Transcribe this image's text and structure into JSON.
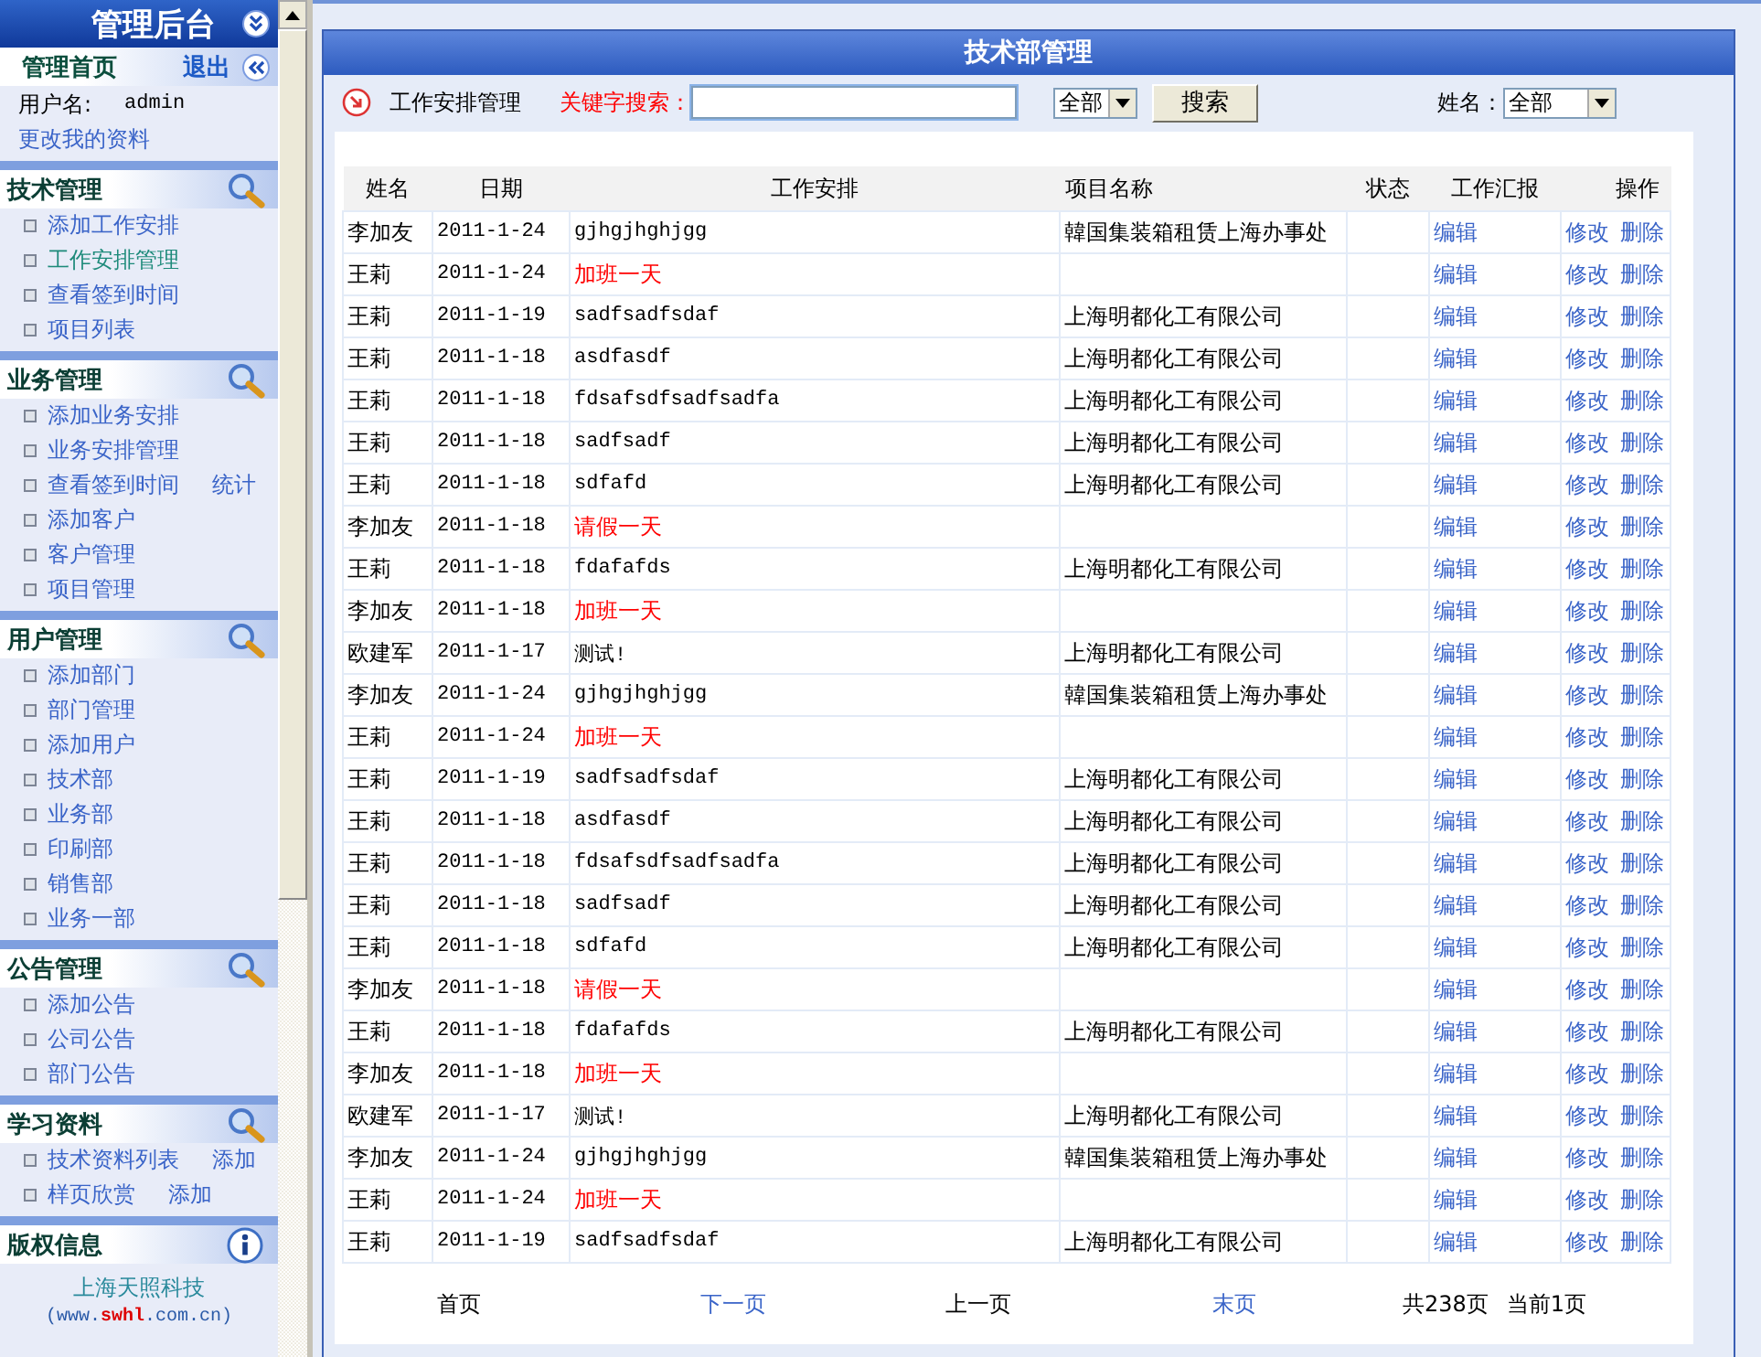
{
  "sidebar": {
    "title": "管理后台",
    "home": "管理首页",
    "logout": "退出",
    "user_label": "用户名:",
    "user": "admin",
    "edit_profile": "更改我的资料",
    "sections": [
      {
        "title": "技术管理",
        "kind": "search",
        "items": [
          {
            "label": "添加工作安排",
            "selected": false
          },
          {
            "label": "工作安排管理",
            "selected": true
          },
          {
            "label": "查看签到时间",
            "selected": false
          },
          {
            "label": "项目列表",
            "selected": false
          }
        ]
      },
      {
        "title": "业务管理",
        "kind": "search",
        "items": [
          {
            "label": "添加业务安排",
            "selected": false
          },
          {
            "label": "业务安排管理",
            "selected": false
          },
          {
            "label": "查看签到时间",
            "extra": "统计",
            "selected": false
          },
          {
            "label": "添加客户",
            "selected": false
          },
          {
            "label": "客户管理",
            "selected": false
          },
          {
            "label": "项目管理",
            "selected": false
          }
        ]
      },
      {
        "title": "用户管理",
        "kind": "search",
        "items": [
          {
            "label": "添加部门",
            "selected": false
          },
          {
            "label": "部门管理",
            "selected": false
          },
          {
            "label": "添加用户",
            "selected": false
          },
          {
            "label": "技术部",
            "selected": false
          },
          {
            "label": "业务部",
            "selected": false
          },
          {
            "label": "印刷部",
            "selected": false
          },
          {
            "label": "销售部",
            "selected": false
          },
          {
            "label": "业务一部",
            "selected": false
          }
        ]
      },
      {
        "title": "公告管理",
        "kind": "search",
        "items": [
          {
            "label": "添加公告",
            "selected": false
          },
          {
            "label": "公司公告",
            "selected": false
          },
          {
            "label": "部门公告",
            "selected": false
          }
        ]
      },
      {
        "title": "学习资料",
        "kind": "search",
        "items": [
          {
            "label": "技术资料列表",
            "extra": "添加",
            "selected": false
          },
          {
            "label": "样页欣赏",
            "extra": "添加",
            "selected": false
          }
        ]
      },
      {
        "title": "版权信息",
        "kind": "info",
        "company": "上海天照科技",
        "url": {
          "before": "(www.",
          "highlight": "swhl",
          "after": ".com.cn)"
        }
      }
    ]
  },
  "panel": {
    "title": "技术部管理",
    "toolbar": {
      "label": "工作安排管理",
      "search_label": "关键字搜索：",
      "category": "全部",
      "search_button": "搜索",
      "name_label": "姓名：",
      "name_filter": "全部"
    },
    "columns": [
      "姓名",
      "日期",
      "工作安排",
      "项目名称",
      "状态",
      "工作汇报",
      "操作"
    ],
    "rows": [
      {
        "name": "李加友",
        "date": "2011-1-24",
        "task": "gjhgjhghjgg",
        "highlight": false,
        "project": "韓国集装箱租赁上海办事处",
        "report": "编辑",
        "actions": [
          "修改",
          "删除"
        ]
      },
      {
        "name": "王莉",
        "date": "2011-1-24",
        "task": "加班一天",
        "highlight": true,
        "report": "编辑",
        "actions": [
          "修改",
          "删除"
        ]
      },
      {
        "name": "王莉",
        "date": "2011-1-19",
        "task": "sadfsadfsdaf",
        "highlight": false,
        "project": "上海明都化工有限公司",
        "report": "编辑",
        "actions": [
          "修改",
          "删除"
        ]
      },
      {
        "name": "王莉",
        "date": "2011-1-18",
        "task": "asdfasdf",
        "highlight": false,
        "project": "上海明都化工有限公司",
        "report": "编辑",
        "actions": [
          "修改",
          "删除"
        ]
      },
      {
        "name": "王莉",
        "date": "2011-1-18",
        "task": "fdsafsdfsadfsadfa",
        "highlight": false,
        "project": "上海明都化工有限公司",
        "report": "编辑",
        "actions": [
          "修改",
          "删除"
        ]
      },
      {
        "name": "王莉",
        "date": "2011-1-18",
        "task": "sadfsadf",
        "highlight": false,
        "project": "上海明都化工有限公司",
        "report": "编辑",
        "actions": [
          "修改",
          "删除"
        ]
      },
      {
        "name": "王莉",
        "date": "2011-1-18",
        "task": "sdfafd",
        "highlight": false,
        "project": "上海明都化工有限公司",
        "report": "编辑",
        "actions": [
          "修改",
          "删除"
        ]
      },
      {
        "name": "李加友",
        "date": "2011-1-18",
        "task": "请假一天",
        "highlight": true,
        "report": "编辑",
        "actions": [
          "修改",
          "删除"
        ]
      },
      {
        "name": "王莉",
        "date": "2011-1-18",
        "task": "fdafafds",
        "highlight": false,
        "project": "上海明都化工有限公司",
        "report": "编辑",
        "actions": [
          "修改",
          "删除"
        ]
      },
      {
        "name": "李加友",
        "date": "2011-1-18",
        "task": "加班一天",
        "highlight": true,
        "report": "编辑",
        "actions": [
          "修改",
          "删除"
        ]
      },
      {
        "name": "欧建军",
        "date": "2011-1-17",
        "task": "测试!",
        "highlight": false,
        "project": "上海明都化工有限公司",
        "report": "编辑",
        "actions": [
          "修改",
          "删除"
        ]
      },
      {
        "name": "李加友",
        "date": "2011-1-24",
        "task": "gjhgjhghjgg",
        "highlight": false,
        "project": "韓国集装箱租赁上海办事处",
        "report": "编辑",
        "actions": [
          "修改",
          "删除"
        ]
      },
      {
        "name": "王莉",
        "date": "2011-1-24",
        "task": "加班一天",
        "highlight": true,
        "report": "编辑",
        "actions": [
          "修改",
          "删除"
        ]
      },
      {
        "name": "王莉",
        "date": "2011-1-19",
        "task": "sadfsadfsdaf",
        "highlight": false,
        "project": "上海明都化工有限公司",
        "report": "编辑",
        "actions": [
          "修改",
          "删除"
        ]
      },
      {
        "name": "王莉",
        "date": "2011-1-18",
        "task": "asdfasdf",
        "highlight": false,
        "project": "上海明都化工有限公司",
        "report": "编辑",
        "actions": [
          "修改",
          "删除"
        ]
      },
      {
        "name": "王莉",
        "date": "2011-1-18",
        "task": "fdsafsdfsadfsadfa",
        "highlight": false,
        "project": "上海明都化工有限公司",
        "report": "编辑",
        "actions": [
          "修改",
          "删除"
        ]
      },
      {
        "name": "王莉",
        "date": "2011-1-18",
        "task": "sadfsadf",
        "highlight": false,
        "project": "上海明都化工有限公司",
        "report": "编辑",
        "actions": [
          "修改",
          "删除"
        ]
      },
      {
        "name": "王莉",
        "date": "2011-1-18",
        "task": "sdfafd",
        "highlight": false,
        "project": "上海明都化工有限公司",
        "report": "编辑",
        "actions": [
          "修改",
          "删除"
        ]
      },
      {
        "name": "李加友",
        "date": "2011-1-18",
        "task": "请假一天",
        "highlight": true,
        "report": "编辑",
        "actions": [
          "修改",
          "删除"
        ]
      },
      {
        "name": "王莉",
        "date": "2011-1-18",
        "task": "fdafafds",
        "highlight": false,
        "project": "上海明都化工有限公司",
        "report": "编辑",
        "actions": [
          "修改",
          "删除"
        ]
      },
      {
        "name": "李加友",
        "date": "2011-1-18",
        "task": "加班一天",
        "highlight": true,
        "report": "编辑",
        "actions": [
          "修改",
          "删除"
        ]
      },
      {
        "name": "欧建军",
        "date": "2011-1-17",
        "task": "测试!",
        "highlight": false,
        "project": "上海明都化工有限公司",
        "report": "编辑",
        "actions": [
          "修改",
          "删除"
        ]
      },
      {
        "name": "李加友",
        "date": "2011-1-24",
        "task": "gjhgjhghjgg",
        "highlight": false,
        "project": "韓国集装箱租赁上海办事处",
        "report": "编辑",
        "actions": [
          "修改",
          "删除"
        ]
      },
      {
        "name": "王莉",
        "date": "2011-1-24",
        "task": "加班一天",
        "highlight": true,
        "report": "编辑",
        "actions": [
          "修改",
          "删除"
        ]
      },
      {
        "name": "王莉",
        "date": "2011-1-19",
        "task": "sadfsadfsdaf",
        "highlight": false,
        "project": "上海明都化工有限公司",
        "report": "编辑",
        "actions": [
          "修改",
          "删除"
        ]
      }
    ],
    "pager": [
      {
        "label": "首页",
        "disabled": true
      },
      {
        "label": "下一页",
        "disabled": false
      },
      {
        "label": "上一页",
        "disabled": true
      },
      {
        "label": "末页",
        "disabled": false
      }
    ],
    "total": "共238页",
    "current": "当前1页"
  }
}
